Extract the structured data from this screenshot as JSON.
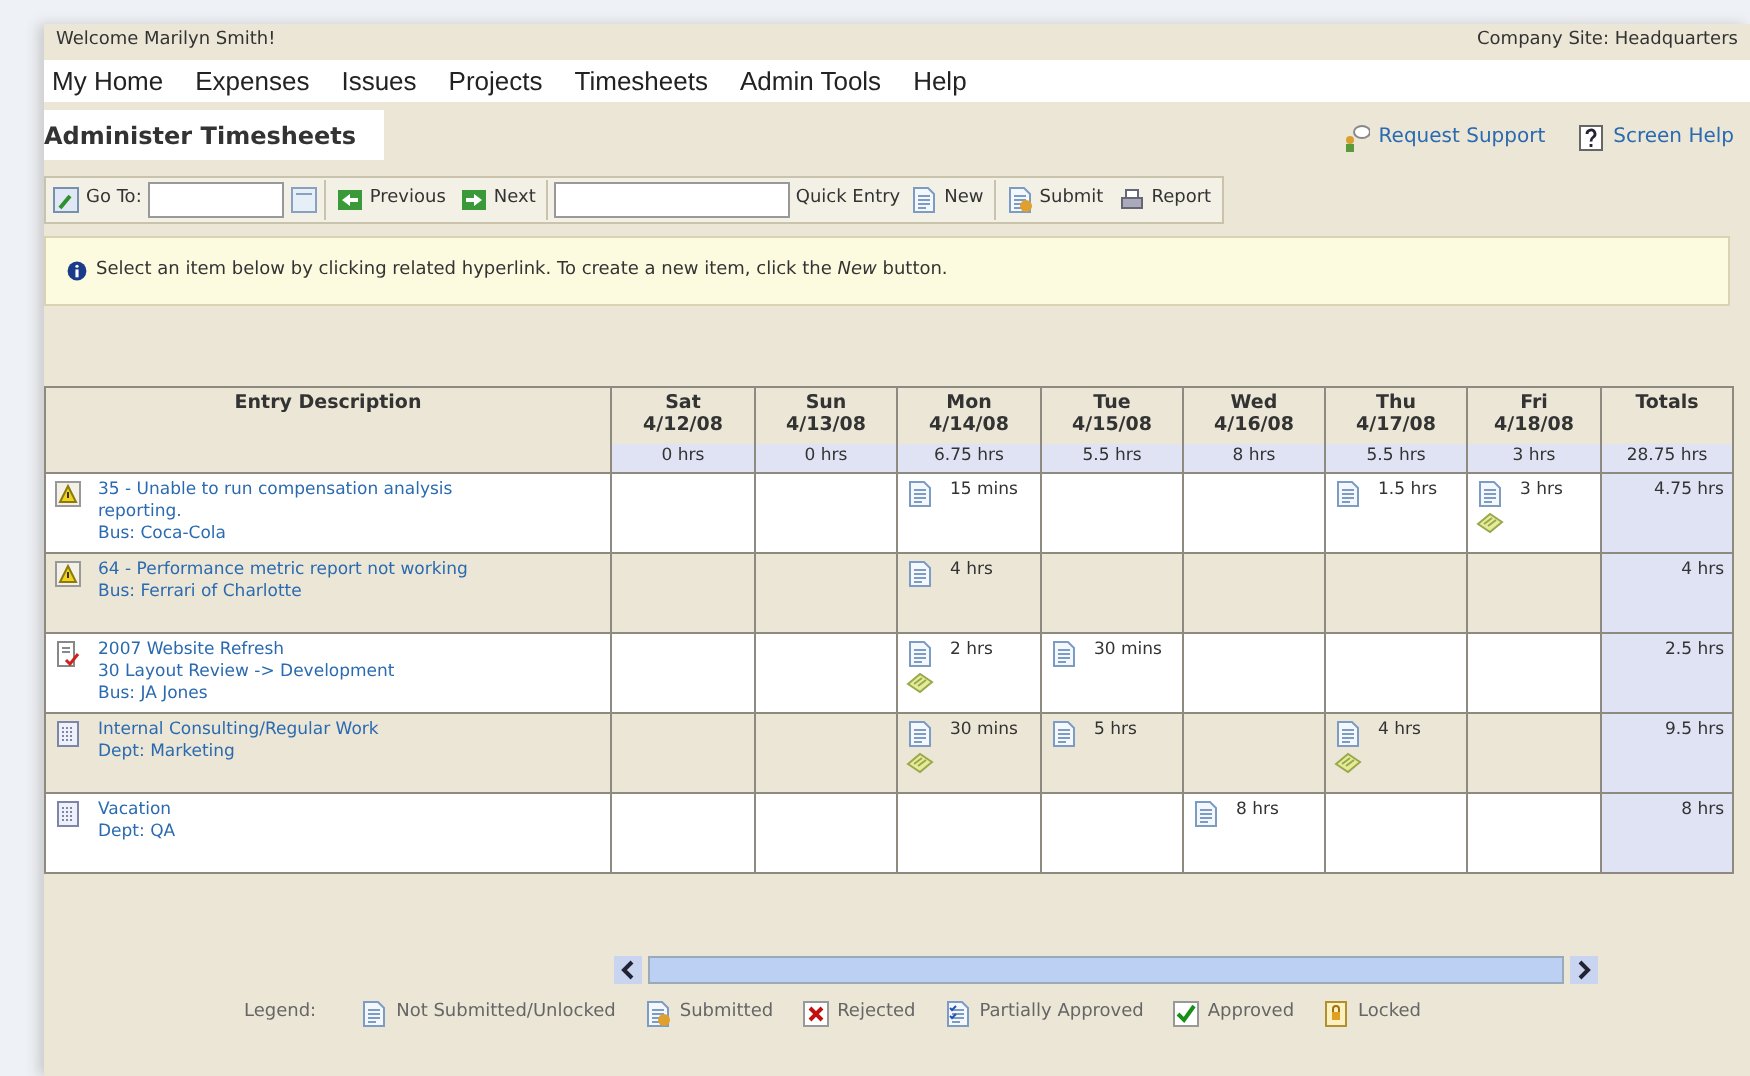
{
  "top_bar": {
    "welcome": "Welcome Marilyn Smith!",
    "site": "Company Site: Headquarters"
  },
  "menu": [
    "My Home",
    "Expenses",
    "Issues",
    "Projects",
    "Timesheets",
    "Admin Tools",
    "Help"
  ],
  "page_title": "Administer Timesheets",
  "header_links": [
    {
      "kind": "support",
      "label": "Request Support"
    },
    {
      "kind": "help",
      "label": "Screen Help"
    }
  ],
  "toolbar": {
    "go_to_label": "Go To:",
    "previous": "Previous",
    "next": "Next",
    "quick_entry": "Quick Entry",
    "new": "New",
    "submit": "Submit",
    "report": "Report"
  },
  "info": "Select an item below by clicking related hyperlink. To create a new item, click the *New* button.",
  "table": {
    "description_heading": "Entry Description",
    "days": [
      {
        "day": "Sat",
        "date": "4/12/08",
        "total": "0 hrs"
      },
      {
        "day": "Sun",
        "date": "4/13/08",
        "total": "0 hrs"
      },
      {
        "day": "Mon",
        "date": "4/14/08",
        "total": "6.75 hrs"
      },
      {
        "day": "Tue",
        "date": "4/15/08",
        "total": "5.5 hrs"
      },
      {
        "day": "Wed",
        "date": "4/16/08",
        "total": "8 hrs"
      },
      {
        "day": "Thu",
        "date": "4/17/08",
        "total": "5.5 hrs"
      },
      {
        "day": "Fri",
        "date": "4/18/08",
        "total": "3 hrs"
      }
    ],
    "totals_heading": "Totals",
    "grand_total": "28.75 hrs",
    "rows": [
      {
        "kind": "issue",
        "lines": [
          "35 - Unable to run compensation analysis reporting.",
          "Bus: Coca-Cola"
        ],
        "cells": [
          null,
          null,
          {
            "value": "15 mins",
            "note": false
          },
          null,
          null,
          {
            "value": "1.5 hrs",
            "note": false
          },
          {
            "value": "3 hrs",
            "note": true
          }
        ],
        "total": "4.75 hrs"
      },
      {
        "kind": "issue",
        "lines": [
          "64 - Performance metric report not working",
          "Bus: Ferrari of Charlotte"
        ],
        "cells": [
          null,
          null,
          {
            "value": "4 hrs",
            "note": false
          },
          null,
          null,
          null,
          null
        ],
        "total": "4 hrs"
      },
      {
        "kind": "project",
        "lines": [
          "2007 Website Refresh",
          "30 Layout Review -> Development",
          "Bus: JA Jones"
        ],
        "cells": [
          null,
          null,
          {
            "value": "2 hrs",
            "note": true
          },
          {
            "value": "30 mins",
            "note": false
          },
          null,
          null,
          null
        ],
        "total": "2.5 hrs"
      },
      {
        "kind": "work",
        "lines": [
          "Internal Consulting/Regular Work",
          "Dept: Marketing"
        ],
        "cells": [
          null,
          null,
          {
            "value": "30 mins",
            "note": true
          },
          {
            "value": "5 hrs",
            "note": false
          },
          null,
          {
            "value": "4 hrs",
            "note": true
          },
          null
        ],
        "total": "9.5 hrs"
      },
      {
        "kind": "work",
        "lines": [
          "Vacation",
          "Dept: QA"
        ],
        "cells": [
          null,
          null,
          null,
          null,
          {
            "value": "8 hrs",
            "note": false
          },
          null,
          null
        ],
        "total": "8 hrs"
      }
    ]
  },
  "legend": {
    "label": "Legend:",
    "items": [
      {
        "kind": "unlocked",
        "label": "Not Submitted/Unlocked"
      },
      {
        "kind": "submitted",
        "label": "Submitted"
      },
      {
        "kind": "rejected",
        "label": "Rejected"
      },
      {
        "kind": "partial",
        "label": "Partially Approved"
      },
      {
        "kind": "approved",
        "label": "Approved"
      },
      {
        "kind": "locked",
        "label": "Locked"
      }
    ]
  }
}
